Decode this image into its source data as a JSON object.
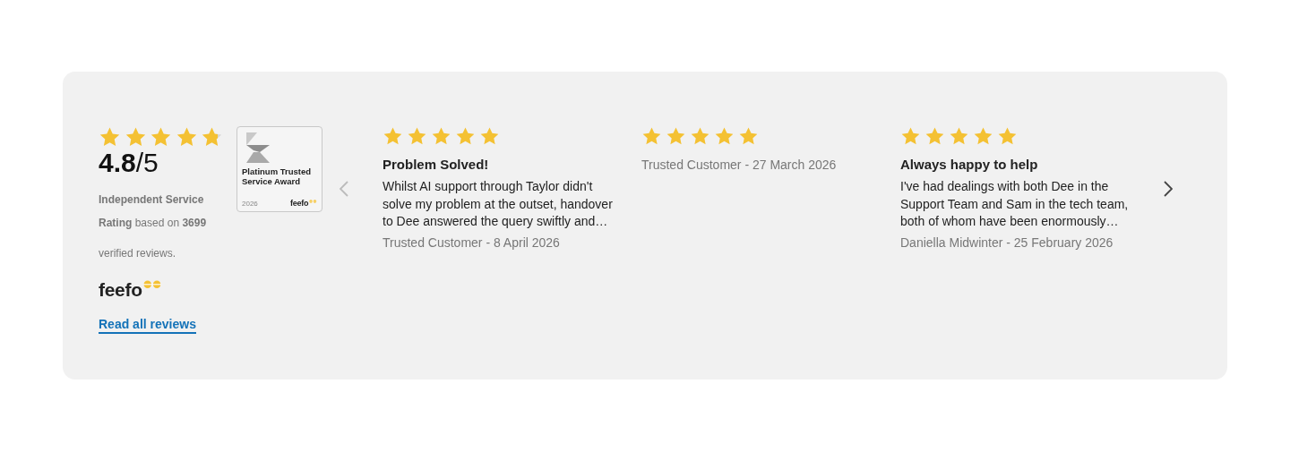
{
  "summary": {
    "stars": 4.8,
    "score": "4.8",
    "out_of": "/5",
    "service": "Independent Service",
    "rating_text": "**Rating** based on **3699** verified reviews.",
    "logo": "feefo",
    "link": "Read all reviews"
  },
  "award": {
    "title": "Platinum Trusted Service Award",
    "year": "2026",
    "logo": "feefo"
  },
  "carousel": {
    "prev_disabled": true,
    "next_disabled": false
  },
  "reviews": [
    {
      "stars": 5,
      "title": "Problem Solved!",
      "body": "Whilst AI support through Taylor didn't solve my problem at the outset, handover to Dee answered the query swiftly and…",
      "byline": "Trusted Customer - 8 April 2026"
    },
    {
      "stars": 5,
      "byline": "Trusted Customer - 27 March 2026"
    },
    {
      "stars": 5,
      "title": "Always happy to help",
      "body": "I've had dealings with both Dee in the Support Team and Sam in the tech team, both of whom have been enormously…",
      "byline": "Daniella Midwinter - 25 February 2026"
    }
  ]
}
